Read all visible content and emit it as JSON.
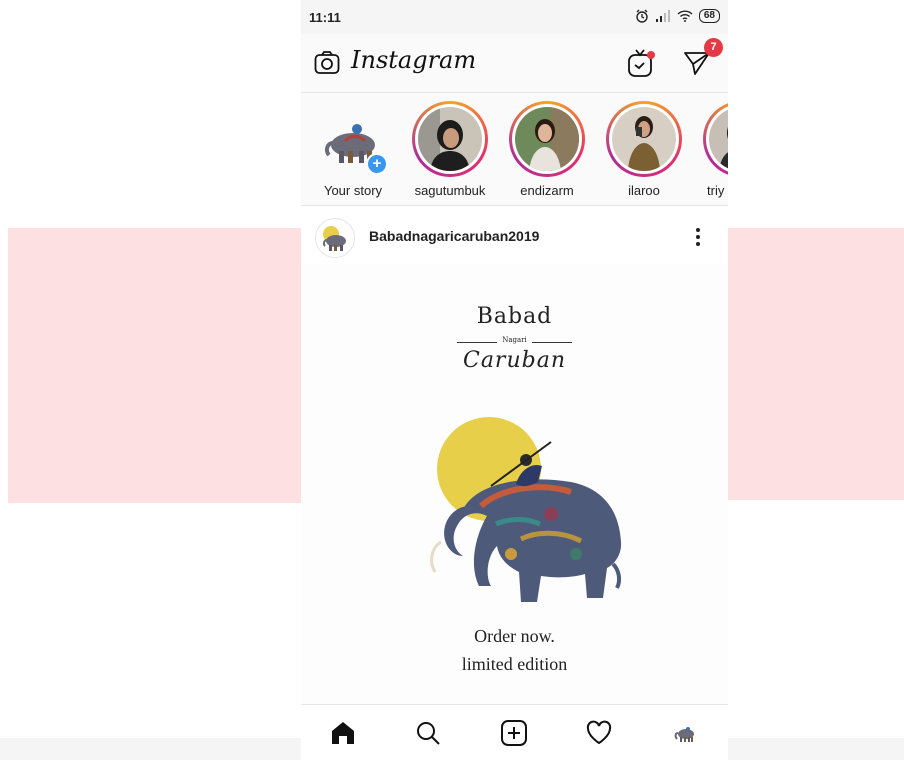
{
  "status_bar": {
    "time": "11:11",
    "battery": "68"
  },
  "app_bar": {
    "logo": "Instagram",
    "dm_badge_count": "7"
  },
  "stories": [
    {
      "label": "Your story",
      "own": true
    },
    {
      "label": "sagutumbuk"
    },
    {
      "label": "endizarm"
    },
    {
      "label": "ilaroo"
    },
    {
      "label": "triy"
    }
  ],
  "post": {
    "username": "Babadnagaricaruban2019",
    "art_title_line1": "Babad",
    "art_title_small": "Nagari",
    "art_title_line2": "Caruban",
    "order_line1": "Order now.",
    "order_line2": "limited edition"
  },
  "colors": {
    "accent_badge": "#e53945",
    "story_plus": "#3897f0",
    "bg_band": "#fde0e1",
    "sun": "#e8cf4a"
  },
  "icons": [
    "camera-icon",
    "igtv-icon",
    "direct-message-icon",
    "more-icon",
    "home-icon",
    "search-icon",
    "add-post-icon",
    "heart-icon",
    "profile-icon"
  ]
}
